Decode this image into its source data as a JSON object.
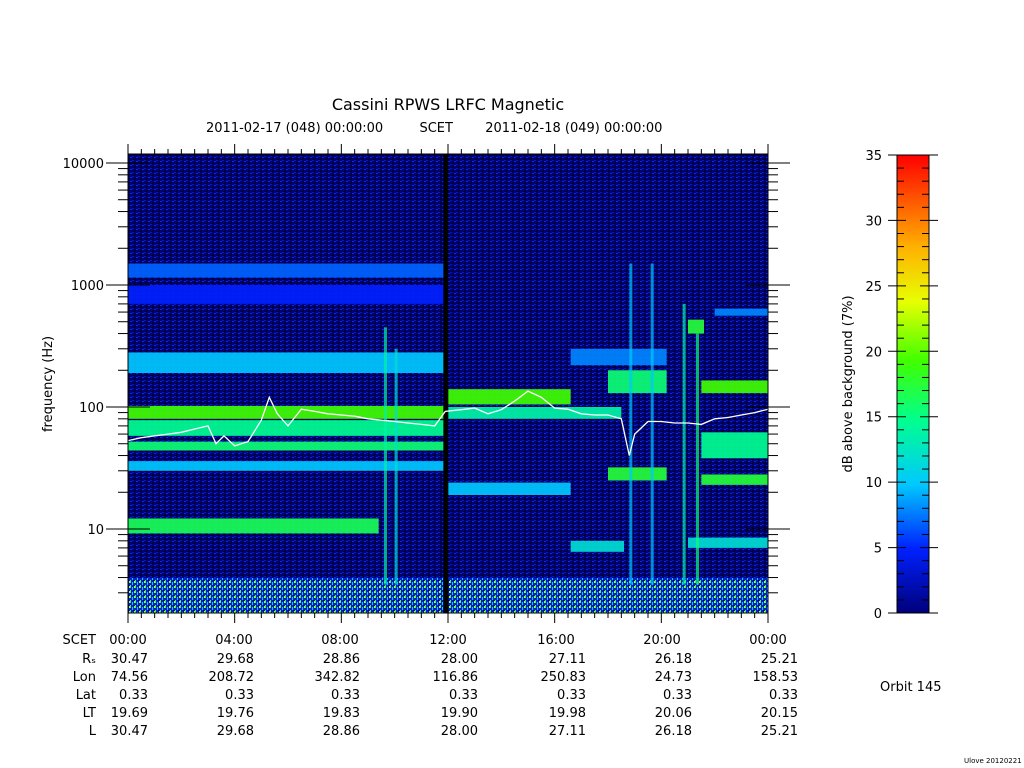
{
  "header": {
    "title": "Cassini RPWS LRFC Magnetic",
    "start_label": "2011-02-17 (048) 00:00:00",
    "scet_label": "SCET",
    "end_label": "2011-02-18 (049) 00:00:00"
  },
  "chart_data": {
    "type": "heatmap",
    "title": "Cassini RPWS LRFC Magnetic",
    "ylabel": "frequency (Hz)",
    "yscale": "log",
    "ylim": [
      2.2,
      12000
    ],
    "y_ticks": [
      10,
      100,
      1000,
      10000
    ],
    "y_tick_labels": [
      "10",
      "100",
      "1000",
      "10000"
    ],
    "x_tick_labels": [
      "00:00",
      "04:00",
      "08:00",
      "12:00",
      "16:00",
      "20:00",
      "00:00"
    ],
    "xlim_hours": [
      0,
      24
    ],
    "colorbar": {
      "label": "dB above background (7%)",
      "range": [
        0,
        35
      ],
      "ticks": [
        0,
        5,
        10,
        15,
        20,
        25,
        30,
        35
      ]
    },
    "data_gap_hours": 11.9,
    "white_trace": {
      "name": "",
      "hours": [
        0,
        0.5,
        1,
        1.5,
        2,
        2.5,
        3,
        3.3,
        3.6,
        4,
        4.5,
        5,
        5.3,
        5.6,
        6,
        6.5,
        7,
        7.5,
        8,
        8.5,
        9,
        9.5,
        10,
        10.5,
        11,
        11.5,
        11.9,
        12.5,
        13,
        13.5,
        14,
        14.5,
        15,
        15.5,
        16,
        16.5,
        17,
        17.5,
        18,
        18.5,
        18.8,
        19,
        19.5,
        20,
        20.5,
        21,
        21.5,
        22,
        22.5,
        23,
        23.5,
        24
      ],
      "hz": [
        53,
        56,
        58,
        60,
        62,
        66,
        70,
        50,
        58,
        48,
        52,
        78,
        120,
        88,
        70,
        96,
        92,
        88,
        86,
        84,
        80,
        78,
        76,
        74,
        72,
        70,
        92,
        95,
        98,
        88,
        95,
        112,
        135,
        120,
        98,
        96,
        88,
        86,
        86,
        80,
        40,
        60,
        76,
        76,
        74,
        74,
        72,
        80,
        82,
        86,
        90,
        96
      ]
    },
    "spectrogram_bands": [
      {
        "t0": 0,
        "t1": 11.9,
        "f0": 80,
        "f1": 102,
        "db": 20
      },
      {
        "t0": 0,
        "t1": 11.9,
        "f0": 58,
        "f1": 78,
        "db": 15
      },
      {
        "t0": 0,
        "t1": 11.9,
        "f0": 44,
        "f1": 52,
        "db": 16
      },
      {
        "t0": 0,
        "t1": 11.9,
        "f0": 30,
        "f1": 36,
        "db": 10
      },
      {
        "t0": 0,
        "t1": 9.4,
        "f0": 9.2,
        "f1": 12.2,
        "db": 17
      },
      {
        "t0": 0,
        "t1": 11.9,
        "f0": 190,
        "f1": 280,
        "db": 10
      },
      {
        "t0": 0,
        "t1": 11.9,
        "f0": 1150,
        "f1": 1500,
        "db": 7
      },
      {
        "t0": 0,
        "t1": 11.9,
        "f0": 700,
        "f1": 1000,
        "db": 5
      },
      {
        "t0": 12.0,
        "t1": 16.6,
        "f0": 105,
        "f1": 140,
        "db": 20
      },
      {
        "t0": 12.0,
        "t1": 18.5,
        "f0": 80,
        "f1": 100,
        "db": 14
      },
      {
        "t0": 12.0,
        "t1": 16.6,
        "f0": 19,
        "f1": 24,
        "db": 10
      },
      {
        "t0": 16.6,
        "t1": 18.6,
        "f0": 6.5,
        "f1": 8,
        "db": 12
      },
      {
        "t0": 18.0,
        "t1": 20.2,
        "f0": 25,
        "f1": 32,
        "db": 18
      },
      {
        "t0": 18.0,
        "t1": 20.2,
        "f0": 130,
        "f1": 200,
        "db": 16
      },
      {
        "t0": 21.5,
        "t1": 24,
        "f0": 130,
        "f1": 165,
        "db": 20
      },
      {
        "t0": 21.5,
        "t1": 24,
        "f0": 38,
        "f1": 62,
        "db": 15
      },
      {
        "t0": 21.5,
        "t1": 24,
        "f0": 23,
        "f1": 28,
        "db": 18
      },
      {
        "t0": 22.0,
        "t1": 24,
        "f0": 560,
        "f1": 640,
        "db": 8
      },
      {
        "t0": 21.0,
        "t1": 21.6,
        "f0": 400,
        "f1": 520,
        "db": 18
      },
      {
        "t0": 21.0,
        "t1": 24,
        "f0": 7,
        "f1": 8.5,
        "db": 12
      },
      {
        "t0": 16.6,
        "t1": 20.2,
        "f0": 220,
        "f1": 300,
        "db": 8
      }
    ]
  },
  "ephemeris": {
    "row_labels": [
      "SCET",
      "Rₛ",
      "Lon",
      "Lat",
      "LT",
      "L"
    ],
    "rows": [
      [
        "30.47",
        "29.68",
        "28.86",
        "28.00",
        "27.11",
        "26.18",
        "25.21"
      ],
      [
        "74.56",
        "208.72",
        "342.82",
        "116.86",
        "250.83",
        "24.73",
        "158.53"
      ],
      [
        "0.33",
        "0.33",
        "0.33",
        "0.33",
        "0.33",
        "0.33",
        "0.33"
      ],
      [
        "19.69",
        "19.76",
        "19.83",
        "19.90",
        "19.98",
        "20.06",
        "20.15"
      ],
      [
        "30.47",
        "29.68",
        "28.86",
        "28.00",
        "27.11",
        "26.18",
        "25.21"
      ]
    ]
  },
  "orbit_label": "Orbit 145",
  "credit": "Ulove 20120221"
}
